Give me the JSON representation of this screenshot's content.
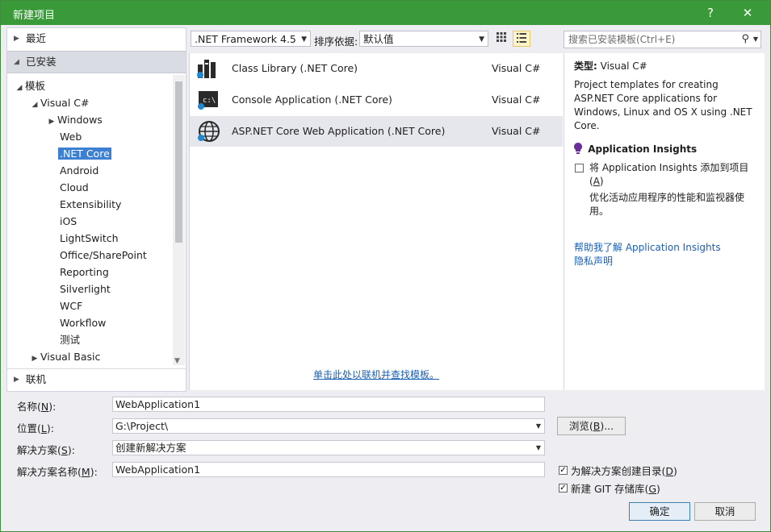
{
  "window": {
    "title": "新建项目",
    "help_symbol": "?",
    "close_symbol": "✕"
  },
  "left": {
    "recent": "最近",
    "installed": "已安装",
    "templates": "模板",
    "visual_csharp": "Visual C#",
    "items": [
      "Windows",
      "Web",
      ".NET Core",
      "Android",
      "Cloud",
      "Extensibility",
      "iOS",
      "LightSwitch",
      "Office/SharePoint",
      "Reporting",
      "Silverlight",
      "WCF",
      "Workflow",
      "测试"
    ],
    "visual_basic": "Visual Basic",
    "online": "联机"
  },
  "toolbar": {
    "framework": ".NET Framework 4.5",
    "sort_label": "排序依据:",
    "sort_value": "默认值",
    "search_placeholder": "搜索已安装模板(Ctrl+E)"
  },
  "templates": [
    {
      "name": "Class Library (.NET Core)",
      "lang": "Visual C#"
    },
    {
      "name": "Console Application (.NET Core)",
      "lang": "Visual C#"
    },
    {
      "name": "ASP.NET Core Web Application (.NET Core)",
      "lang": "Visual C#"
    }
  ],
  "online_link": "单击此处以联机并查找模板。",
  "details": {
    "type_label": "类型:",
    "type_value": "Visual C#",
    "description": "Project templates for creating ASP.NET Core applications for Windows, Linux and OS X using .NET Core.",
    "ai_title": "Application Insights",
    "ai_check_before": "将 Application Insights 添加到项目(",
    "ai_check_key": "A",
    "ai_check_after": ")",
    "ai_desc": "优化活动应用程序的性能和监视器使用。",
    "help_link": "帮助我了解 Application Insights",
    "privacy_link": "隐私声明"
  },
  "form": {
    "name_label": "名称(",
    "name_key": "N",
    "name_end": "):",
    "name_value": "WebApplication1",
    "location_label": "位置(",
    "location_key": "L",
    "location_end": "):",
    "location_value": "G:\\Project\\",
    "solution_label": "解决方案(",
    "solution_key": "S",
    "solution_end": "):",
    "solution_value": "创建新解决方案",
    "solution_name_label": "解决方案名称(",
    "solution_name_key": "M",
    "solution_name_end": "):",
    "solution_name_value": "WebApplication1",
    "browse_label": "浏览(",
    "browse_key": "B",
    "browse_end": ")...",
    "create_dir_label": "为解决方案创建目录(",
    "create_dir_key": "D",
    "create_dir_end": ")",
    "create_git_label": "新建 GIT 存储库(",
    "create_git_key": "G",
    "create_git_end": ")",
    "ok": "确定",
    "cancel": "取消"
  }
}
